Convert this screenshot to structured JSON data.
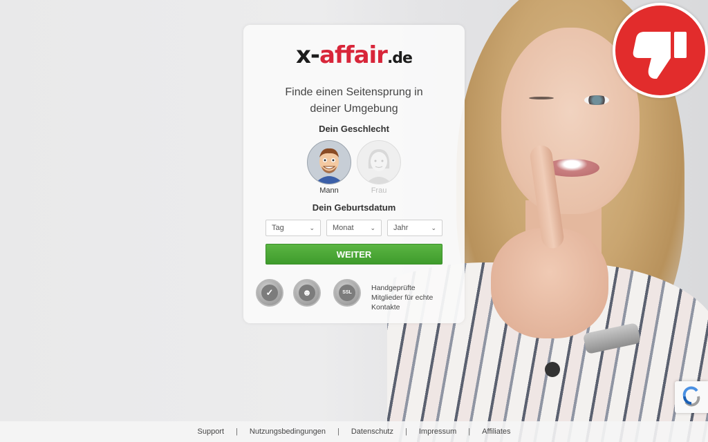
{
  "logo": {
    "part1": "x-",
    "part2": "affair",
    "part3": ".de"
  },
  "tagline": {
    "line1": "Finde einen Seitensprung in",
    "line2": "deiner Umgebung"
  },
  "gender": {
    "heading": "Dein Geschlecht",
    "male_label": "Mann",
    "female_label": "Frau"
  },
  "dob": {
    "heading": "Dein Geburtsdatum",
    "day_value": "Tag",
    "month_value": "Monat",
    "year_value": "Jahr"
  },
  "submit_label": "WEITER",
  "trust": {
    "line1": "Handgeprüfte",
    "line2": "Mitglieder für echte",
    "line3": "Kontakte",
    "ssl_badge": "SSL"
  },
  "footer": {
    "links": [
      "Support",
      "Nutzungsbedingungen",
      "Datenschutz",
      "Impressum",
      "Affiliates"
    ],
    "separator": "|"
  },
  "icons": {
    "thumbs_down": "thumbs-down-icon",
    "check_badge": "check-badge-icon",
    "people_badge": "people-badge-icon",
    "ssl_badge": "ssl-lock-icon",
    "recaptcha": "recaptcha-icon"
  },
  "colors": {
    "brand_red": "#d8263a",
    "button_green": "#4aa836",
    "thumb_red": "#e22c2c"
  }
}
